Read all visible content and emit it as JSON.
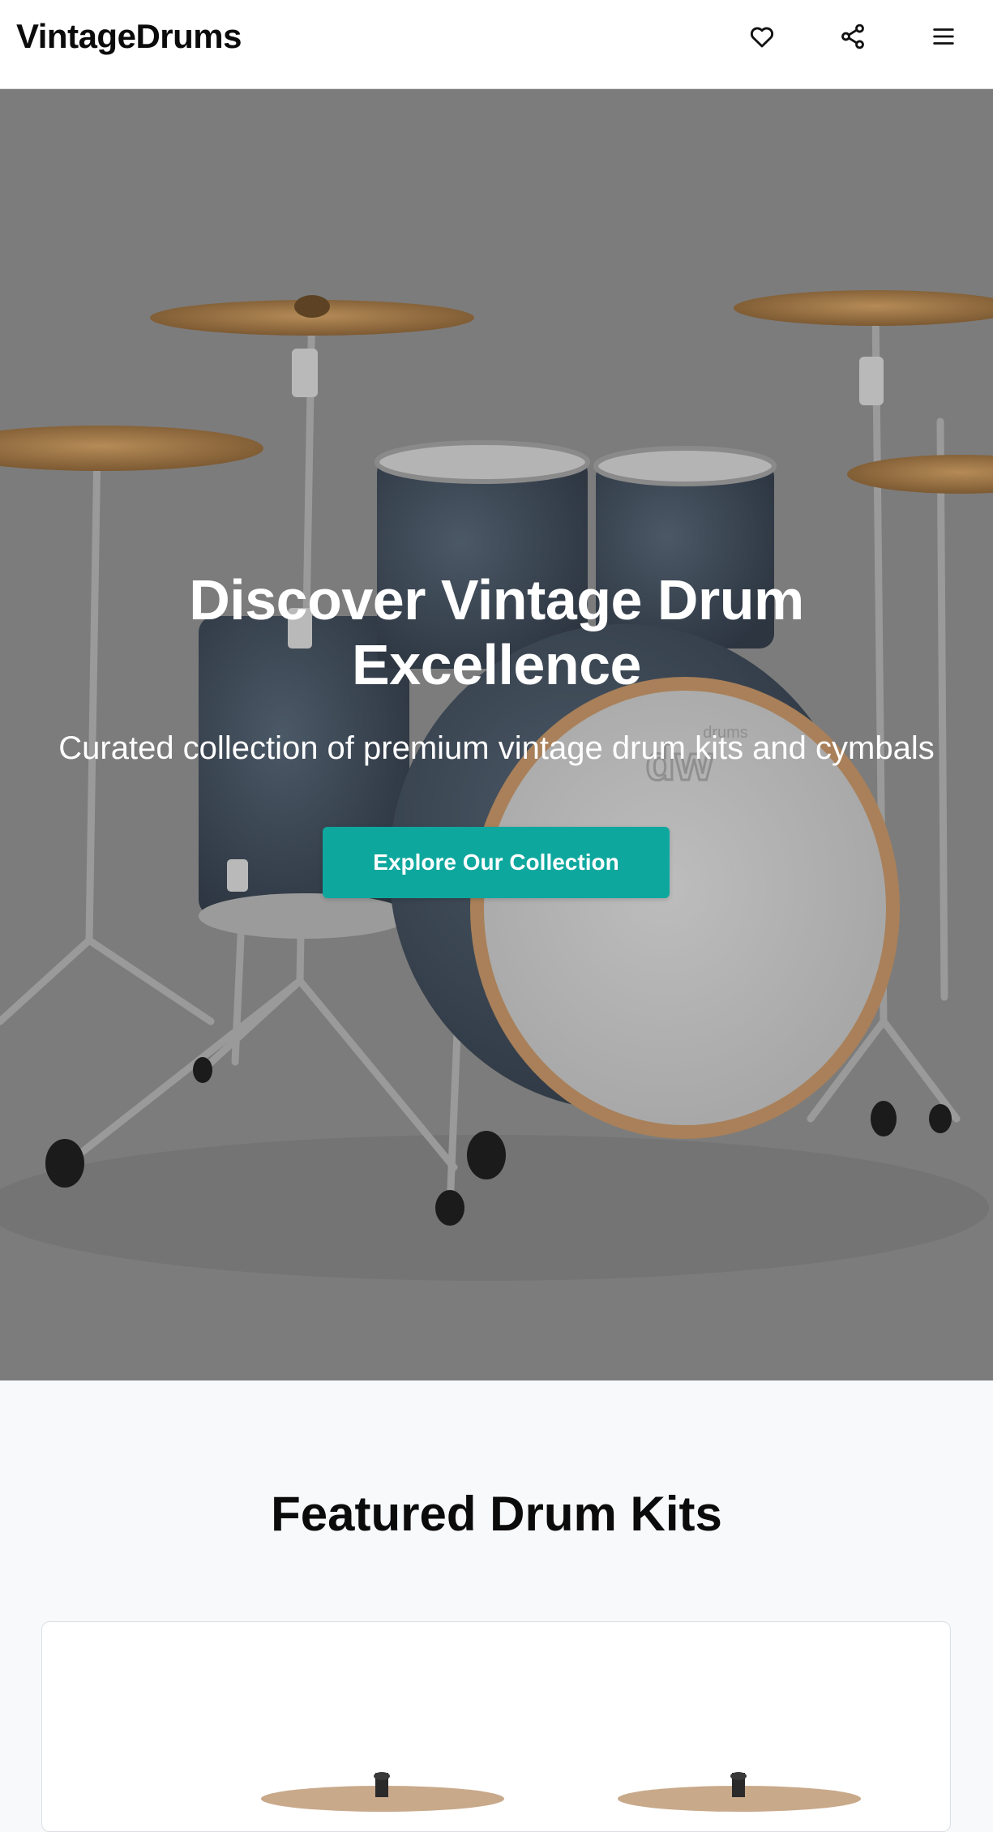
{
  "header": {
    "brand": "VintageDrums",
    "icons": [
      "heart-icon",
      "share-icon",
      "menu-icon"
    ]
  },
  "hero": {
    "title_line1": "Discover Vintage Drum",
    "title_line2": "Excellence",
    "subtitle": "Curated collection of premium vintage drum kits and cymbals",
    "cta_label": "Explore Our Collection",
    "image": "drum-kit-photo"
  },
  "featured": {
    "title": "Featured Drum Kits",
    "card_image": "drum-kit-cymbals-photo"
  },
  "colors": {
    "accent": "#0ea79e",
    "hero_overlay": "#7c7c7c",
    "page_bg": "#f8f9fb",
    "header_bg": "#ffffff",
    "text": "#0b0b0b"
  }
}
